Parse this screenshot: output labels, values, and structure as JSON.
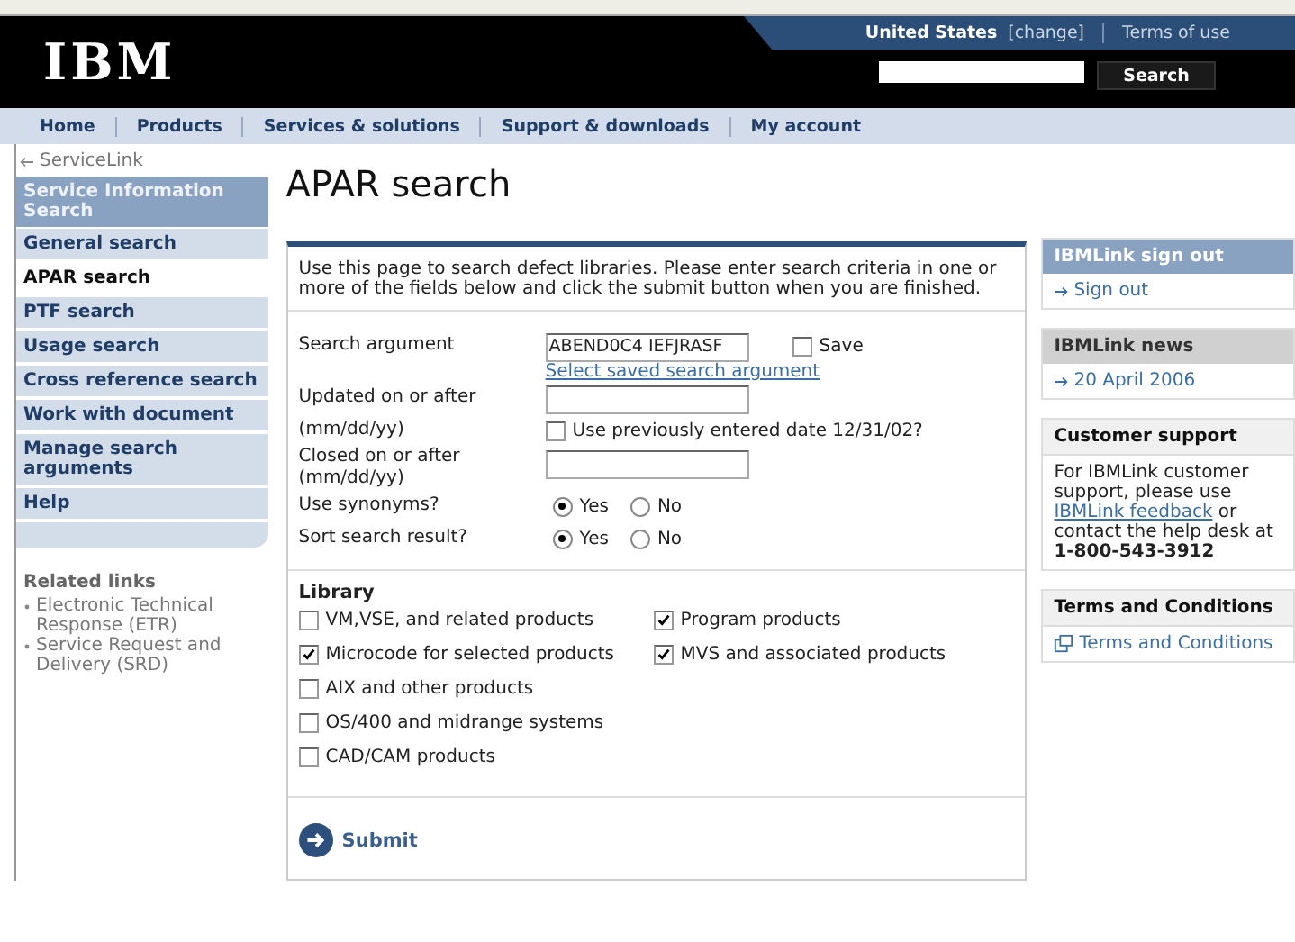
{
  "header": {
    "logo": "IBM",
    "country": "United States",
    "change": "[change]",
    "terms": "Terms of use",
    "search_button": "Search"
  },
  "nav": [
    "Home",
    "Products",
    "Services & solutions",
    "Support & downloads",
    "My account"
  ],
  "sidebar": {
    "back": "ServiceLink",
    "section": "Service Information Search",
    "items": [
      {
        "label": "General search",
        "selected": false
      },
      {
        "label": "APAR search",
        "selected": true
      },
      {
        "label": "PTF search",
        "selected": false
      },
      {
        "label": "Usage search",
        "selected": false
      },
      {
        "label": "Cross reference search",
        "selected": false
      },
      {
        "label": "Work with document",
        "selected": false
      },
      {
        "label": "Manage search arguments",
        "selected": false
      },
      {
        "label": "Help",
        "selected": false
      }
    ],
    "related_title": "Related links",
    "related_links": [
      "Electronic Technical Response (ETR)",
      "Service Request and Delivery (SRD)"
    ]
  },
  "main": {
    "title": "APAR search",
    "intro": "Use this page to search defect libraries. Please enter search criteria in one or more of the fields below and click the submit button when you are finished.",
    "search_argument": {
      "label": "Search argument",
      "value": "ABEND0C4 IEFJRASF",
      "save_label": "Save",
      "save_checked": false,
      "saved_link": "Select saved search argument"
    },
    "updated": {
      "label_1": "Updated on or after",
      "label_2": "(mm/dd/yy)",
      "previous_label": "Use previously entered date 12/31/02?",
      "previous_checked": false
    },
    "closed": {
      "label": "Closed on or after (mm/dd/yy)"
    },
    "radios": [
      {
        "label": "Use synonyms?",
        "options": [
          {
            "label": "Yes",
            "selected": true
          },
          {
            "label": "No",
            "selected": false
          }
        ]
      },
      {
        "label": "Sort search result?",
        "options": [
          {
            "label": "Yes",
            "selected": true
          },
          {
            "label": "No",
            "selected": false
          }
        ]
      }
    ],
    "library_title": "Library",
    "library": [
      {
        "label": "VM,VSE, and related products",
        "checked": false
      },
      {
        "label": "Program products",
        "checked": true
      },
      {
        "label": "Microcode for selected products",
        "checked": true
      },
      {
        "label": "MVS and associated products",
        "checked": true
      },
      {
        "label": "AIX and other products",
        "checked": false
      },
      {
        "label": "OS/400 and midrange systems",
        "checked": false
      },
      {
        "label": "CAD/CAM products",
        "checked": false
      }
    ],
    "submit": "Submit"
  },
  "right": {
    "signout_title": "IBMLink sign out",
    "signout_link": "Sign out",
    "news_title": "IBMLink news",
    "news_link": "20 April 2006",
    "support_title": "Customer support",
    "support_before": "For IBMLink customer support,  please use",
    "support_link": "IBMLink feedback",
    "support_after": "or contact the help desk at",
    "support_phone": "1-800-543-3912",
    "terms_title": "Terms and Conditions",
    "terms_link": "Terms and Conditions"
  }
}
